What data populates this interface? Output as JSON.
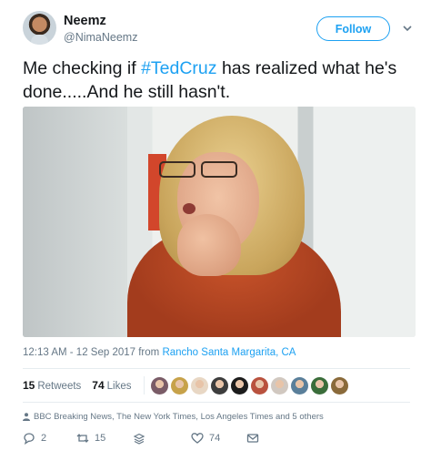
{
  "user": {
    "name": "Neemz",
    "handle": "@NimaNeemz",
    "avatar_icon": "avatar-photo"
  },
  "follow_label": "Follow",
  "tweet": {
    "before": "Me checking if ",
    "hashtag": "#TedCruz",
    "after": " has realized what he's done.....And he still hasn't."
  },
  "media": {
    "description_icon": "video-still-woman-glasses"
  },
  "meta": {
    "time": "12:13 AM - 12 Sep 2017",
    "from_label": " from ",
    "place": "Rancho Santa Margarita, CA"
  },
  "stats": {
    "retweets_count": "15",
    "retweets_label": "Retweets",
    "likes_count": "74",
    "likes_label": "Likes",
    "liker_avatar_colors": [
      "#7a5c67",
      "#c7a24a",
      "#e8d7c4",
      "#3d3d3d",
      "#1c1c1c",
      "#b9523e",
      "#d1c8c0",
      "#5a7f9a",
      "#3a6d3a",
      "#8a6a3a"
    ]
  },
  "context": {
    "text": "BBC Breaking News, The New York Times, Los Angeles Times and 5 others"
  },
  "actions": {
    "replies": "2",
    "retweets": "15",
    "likes": "74"
  },
  "colors": {
    "accent": "#1da1f2",
    "muted": "#657786",
    "text": "#14171a"
  }
}
